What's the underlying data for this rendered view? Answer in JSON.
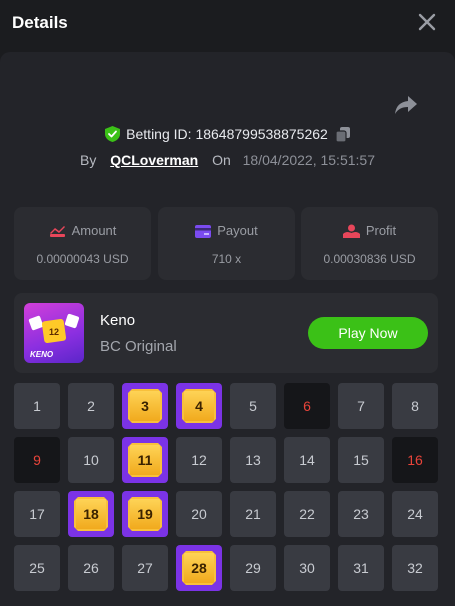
{
  "header": {
    "title": "Details"
  },
  "bet": {
    "label": "Betting ID:",
    "id": "18648799538875262",
    "by_label": "By",
    "user": "QCLoverman",
    "on_label": "On",
    "datetime": "18/04/2022, 15:51:57"
  },
  "stats": [
    {
      "label": "Amount",
      "value": "0.00000043 USD",
      "icon": "amount-icon",
      "color": "#e8465a"
    },
    {
      "label": "Payout",
      "value": "710 x",
      "icon": "payout-icon",
      "color": "#7b4bf0"
    },
    {
      "label": "Profit",
      "value": "0.00030836 USD",
      "icon": "profit-icon",
      "color": "#e8465a"
    }
  ],
  "game": {
    "name": "Keno",
    "subtitle": "BC Original",
    "play_label": "Play Now",
    "thumb_text": "KENO",
    "thumb_ball": "12"
  },
  "keno": {
    "cells": [
      {
        "n": "1",
        "s": "normal"
      },
      {
        "n": "2",
        "s": "normal"
      },
      {
        "n": "3",
        "s": "hit"
      },
      {
        "n": "4",
        "s": "hit"
      },
      {
        "n": "5",
        "s": "normal"
      },
      {
        "n": "6",
        "s": "miss"
      },
      {
        "n": "7",
        "s": "normal"
      },
      {
        "n": "8",
        "s": "normal"
      },
      {
        "n": "9",
        "s": "miss"
      },
      {
        "n": "10",
        "s": "normal"
      },
      {
        "n": "11",
        "s": "hit"
      },
      {
        "n": "12",
        "s": "normal"
      },
      {
        "n": "13",
        "s": "normal"
      },
      {
        "n": "14",
        "s": "normal"
      },
      {
        "n": "15",
        "s": "normal"
      },
      {
        "n": "16",
        "s": "miss"
      },
      {
        "n": "17",
        "s": "normal"
      },
      {
        "n": "18",
        "s": "hit"
      },
      {
        "n": "19",
        "s": "hit"
      },
      {
        "n": "20",
        "s": "normal"
      },
      {
        "n": "21",
        "s": "normal"
      },
      {
        "n": "22",
        "s": "normal"
      },
      {
        "n": "23",
        "s": "normal"
      },
      {
        "n": "24",
        "s": "normal"
      },
      {
        "n": "25",
        "s": "normal"
      },
      {
        "n": "26",
        "s": "normal"
      },
      {
        "n": "27",
        "s": "normal"
      },
      {
        "n": "28",
        "s": "hit"
      },
      {
        "n": "29",
        "s": "normal"
      },
      {
        "n": "30",
        "s": "normal"
      },
      {
        "n": "31",
        "s": "normal"
      },
      {
        "n": "32",
        "s": "normal"
      }
    ]
  }
}
